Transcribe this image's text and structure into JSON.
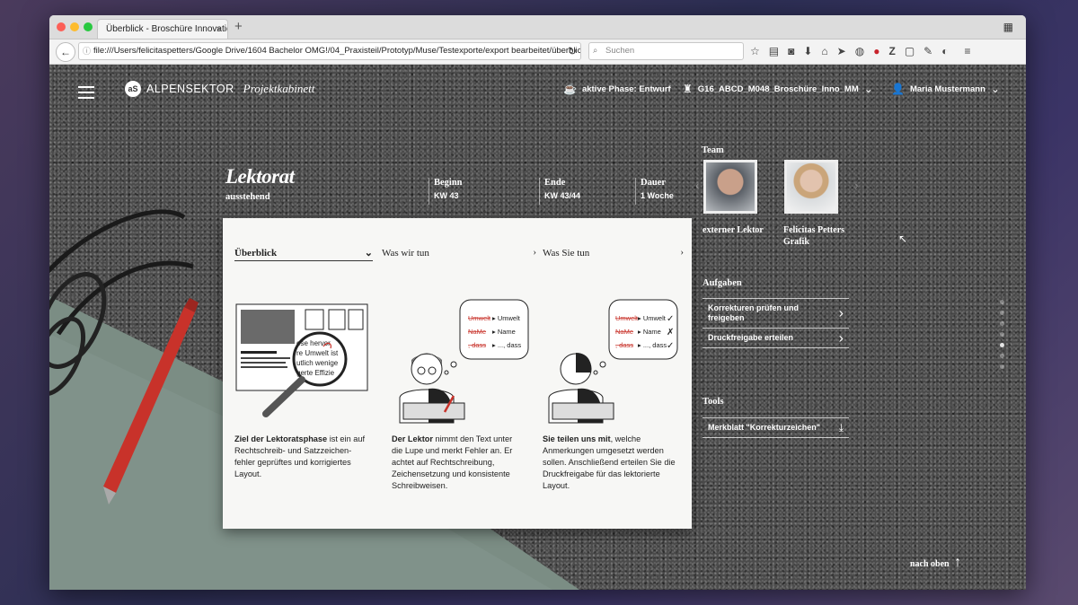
{
  "browser": {
    "tab_title": "Überblick - Broschüre Innovatio…",
    "tab_close": "×",
    "new_tab": "+",
    "url": "file:///Users/felicitaspetters/Google Drive/1604 Bachelor OMG!/04_Praxisteil/Prototyp/Muse/Testexporte/export bearbeitet/überblick",
    "search_placeholder": "Suchen"
  },
  "header": {
    "logo_mark": "aS",
    "brand": "ALPENSEKTOR",
    "sub": "Projektkabinett",
    "phase_label": "aktive Phase: Entwurf",
    "project": "G16_ABCD_M048_Broschüre_Inno_MM",
    "user": "Maria Mustermann"
  },
  "phase": {
    "title": "Lektorat",
    "status": "ausstehend",
    "meta": [
      {
        "key": "Beginn",
        "value": "KW 43"
      },
      {
        "key": "Ende",
        "value": "KW 43/44"
      },
      {
        "key": "Dauer",
        "value": "1 Woche"
      }
    ]
  },
  "card": {
    "tabs": [
      {
        "label": "Überblick",
        "icon": "chevron-down-icon"
      },
      {
        "label": "Was wir tun",
        "icon": "chevron-right-icon"
      },
      {
        "label": "Was Sie tun",
        "icon": "chevron-right-icon"
      }
    ],
    "illustration_words": {
      "w1": "Umwelt",
      "w2": "Name",
      "w3": "..., dass",
      "mag_text": "ese hervor|re Umwelt ist|utlich wenige|gerte Effizie"
    },
    "columns": [
      {
        "bold": "Ziel der Lektoratsphase",
        "text": " ist ein auf Rechtschreib- und Satzzeichen­fehler geprüftes und korrigiertes Layout."
      },
      {
        "bold": "Der Lektor",
        "text": " nimmt den Text unter die Lupe und merkt Fehler an. Er achtet auf Rechtschreibung, Zeichensetzung und konsistente Schreibweisen."
      },
      {
        "bold": "Sie teilen uns mit",
        "text": ", welche Anmerkungen umgesetzt werden sollen. Anschließend erteilen Sie die Druckfreigabe für das lektorierte Layout."
      }
    ]
  },
  "team": {
    "heading": "Team",
    "members": [
      {
        "name": "externer Lektor",
        "role": ""
      },
      {
        "name": "Felicitas Petters",
        "role": "Grafik"
      }
    ]
  },
  "tasks": {
    "heading": "Aufgaben",
    "items": [
      "Korrekturen prüfen und freigeben",
      "Druckfreigabe erteilen"
    ]
  },
  "tools": {
    "heading": "Tools",
    "items": [
      "Merkblatt \"Korrekturzeichen\""
    ]
  },
  "to_top": "nach oben",
  "colors": {
    "accent_red": "#c8322a",
    "paper_green": "#7b8d84"
  }
}
